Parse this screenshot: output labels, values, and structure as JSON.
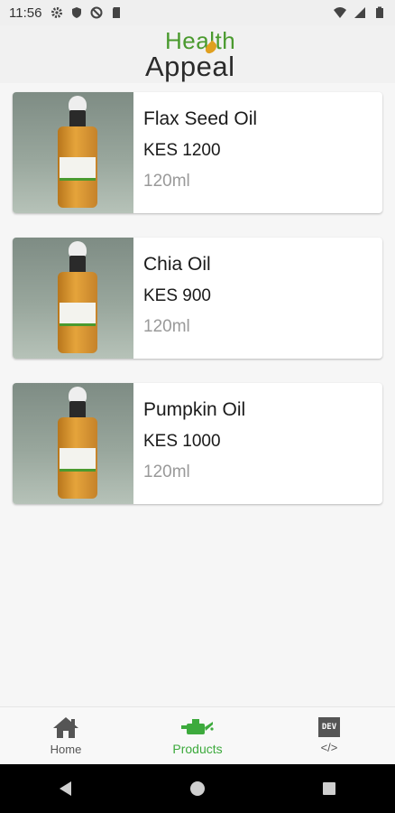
{
  "status_bar": {
    "time": "11:56",
    "left_icons": [
      "gear-icon",
      "shield-icon",
      "no-entry-icon",
      "sd-card-icon"
    ],
    "right_icons": [
      "wifi-icon",
      "signal-icon",
      "battery-icon"
    ]
  },
  "header": {
    "logo_line1": "Health",
    "logo_line2": "Appeal"
  },
  "products": [
    {
      "name": "Flax Seed Oil",
      "price": "KES 1200",
      "size": "120ml"
    },
    {
      "name": "Chia Oil",
      "price": "KES 900",
      "size": "120ml"
    },
    {
      "name": "Pumpkin Oil",
      "price": "KES 1000",
      "size": "120ml"
    }
  ],
  "bottom_nav": {
    "items": [
      {
        "label": "Home",
        "icon": "home-icon",
        "active": false
      },
      {
        "label": "Products",
        "icon": "oil-can-icon",
        "active": true
      },
      {
        "label": "</>",
        "icon": "dev-icon",
        "icon_text": "DEV",
        "active": false
      }
    ]
  },
  "colors": {
    "accent": "#3daa3d",
    "logo_green": "#4a9a2e",
    "logo_orange": "#e0a020"
  }
}
